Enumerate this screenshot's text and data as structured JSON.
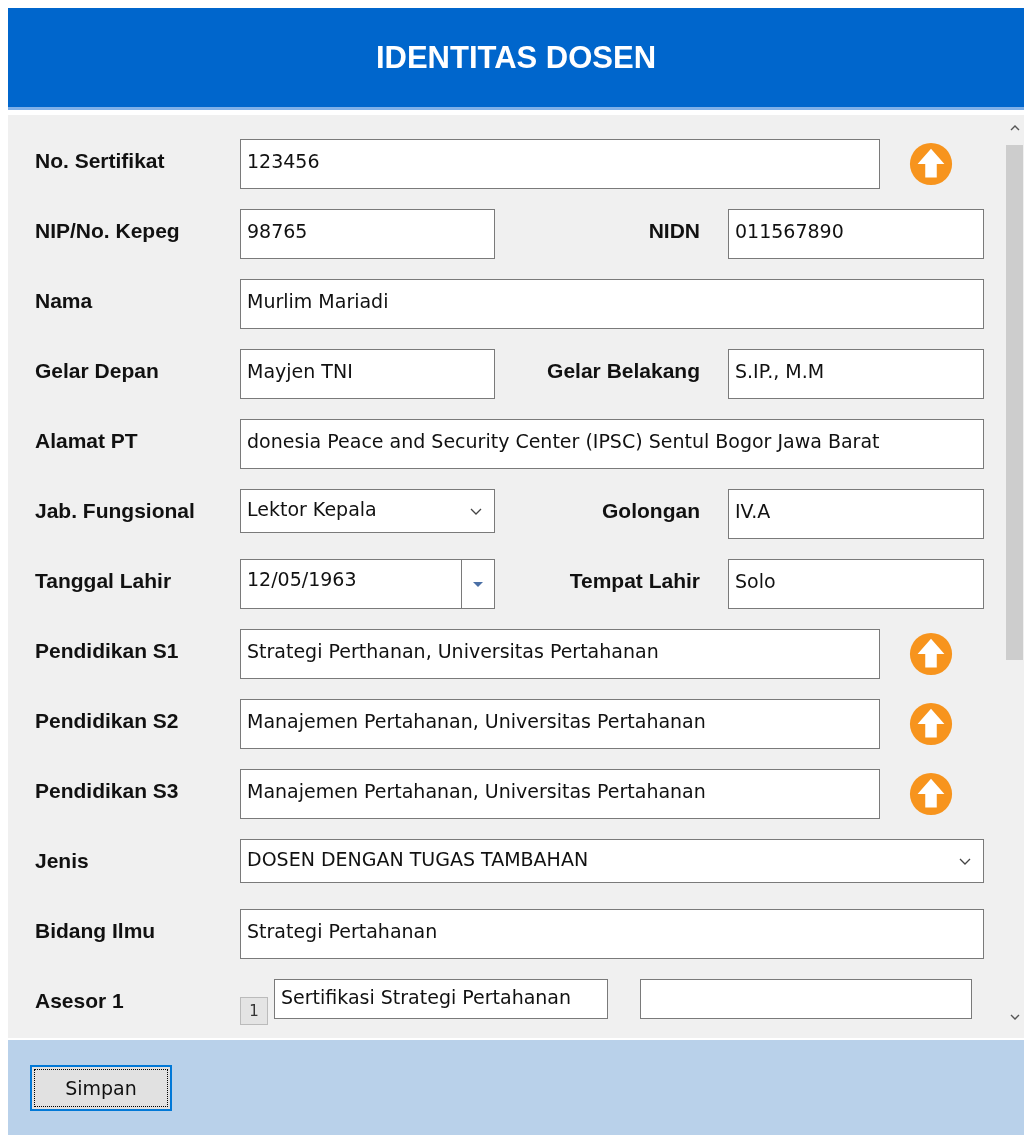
{
  "window": {
    "title": "IDENTITAS DOSEN"
  },
  "rows": [
    {
      "label": "No. Sertifikat",
      "field": {
        "kind": "text",
        "value": "123456"
      },
      "upload": true
    },
    {
      "label": "NIP/No. Kepeg",
      "field": {
        "kind": "text",
        "value": "98765"
      },
      "upload": false,
      "right": {
        "label": "NIDN",
        "field": {
          "kind": "text",
          "value": "011567890"
        }
      }
    },
    {
      "label": "Nama",
      "field": {
        "kind": "text",
        "value": "Murlim Mariadi"
      },
      "upload": false
    },
    {
      "label": "Gelar Depan",
      "field": {
        "kind": "text",
        "value": "Mayjen TNI"
      },
      "upload": false,
      "right": {
        "label": "Gelar Belakang",
        "field": {
          "kind": "text",
          "value": "S.IP., M.M"
        }
      }
    },
    {
      "label": "Alamat PT",
      "field": {
        "kind": "text",
        "value": "donesia Peace and Security Center (IPSC) Sentul Bogor Jawa Barat"
      },
      "upload": false
    },
    {
      "label": "Jab. Fungsional",
      "field": {
        "kind": "select",
        "value": "Lektor Kepala"
      },
      "upload": false,
      "right": {
        "label": "Golongan",
        "field": {
          "kind": "text",
          "value": "IV.A"
        }
      }
    },
    {
      "label": "Tanggal Lahir",
      "field": {
        "kind": "date",
        "value": "12/05/1963"
      },
      "upload": false,
      "right": {
        "label": "Tempat Lahir",
        "field": {
          "kind": "text",
          "value": "Solo"
        }
      }
    },
    {
      "label": "Pendidikan S1",
      "field": {
        "kind": "text",
        "value": "Strategi Perthanan, Universitas Pertahanan"
      },
      "upload": true
    },
    {
      "label": "Pendidikan S2",
      "field": {
        "kind": "text",
        "value": "Manajemen Pertahanan, Universitas Pertahanan"
      },
      "upload": true
    },
    {
      "label": "Pendidikan S3",
      "field": {
        "kind": "text",
        "value": "Manajemen Pertahanan, Universitas Pertahanan"
      },
      "upload": true
    },
    {
      "label": "Jenis",
      "field": {
        "kind": "select",
        "value": "DOSEN DENGAN TUGAS TAMBAHAN"
      },
      "upload": false
    },
    {
      "label": "Bidang Ilmu",
      "field": {
        "kind": "text",
        "value": "Strategi Pertahanan"
      },
      "upload": false
    },
    {
      "label": "Asesor 1",
      "field": {
        "kind": "asesor",
        "number": "1",
        "value": "Sertifikasi Strategi Pertahanan"
      },
      "upload": false
    }
  ],
  "buttons": [
    {
      "label": "Simpan",
      "focused": true
    }
  ]
}
